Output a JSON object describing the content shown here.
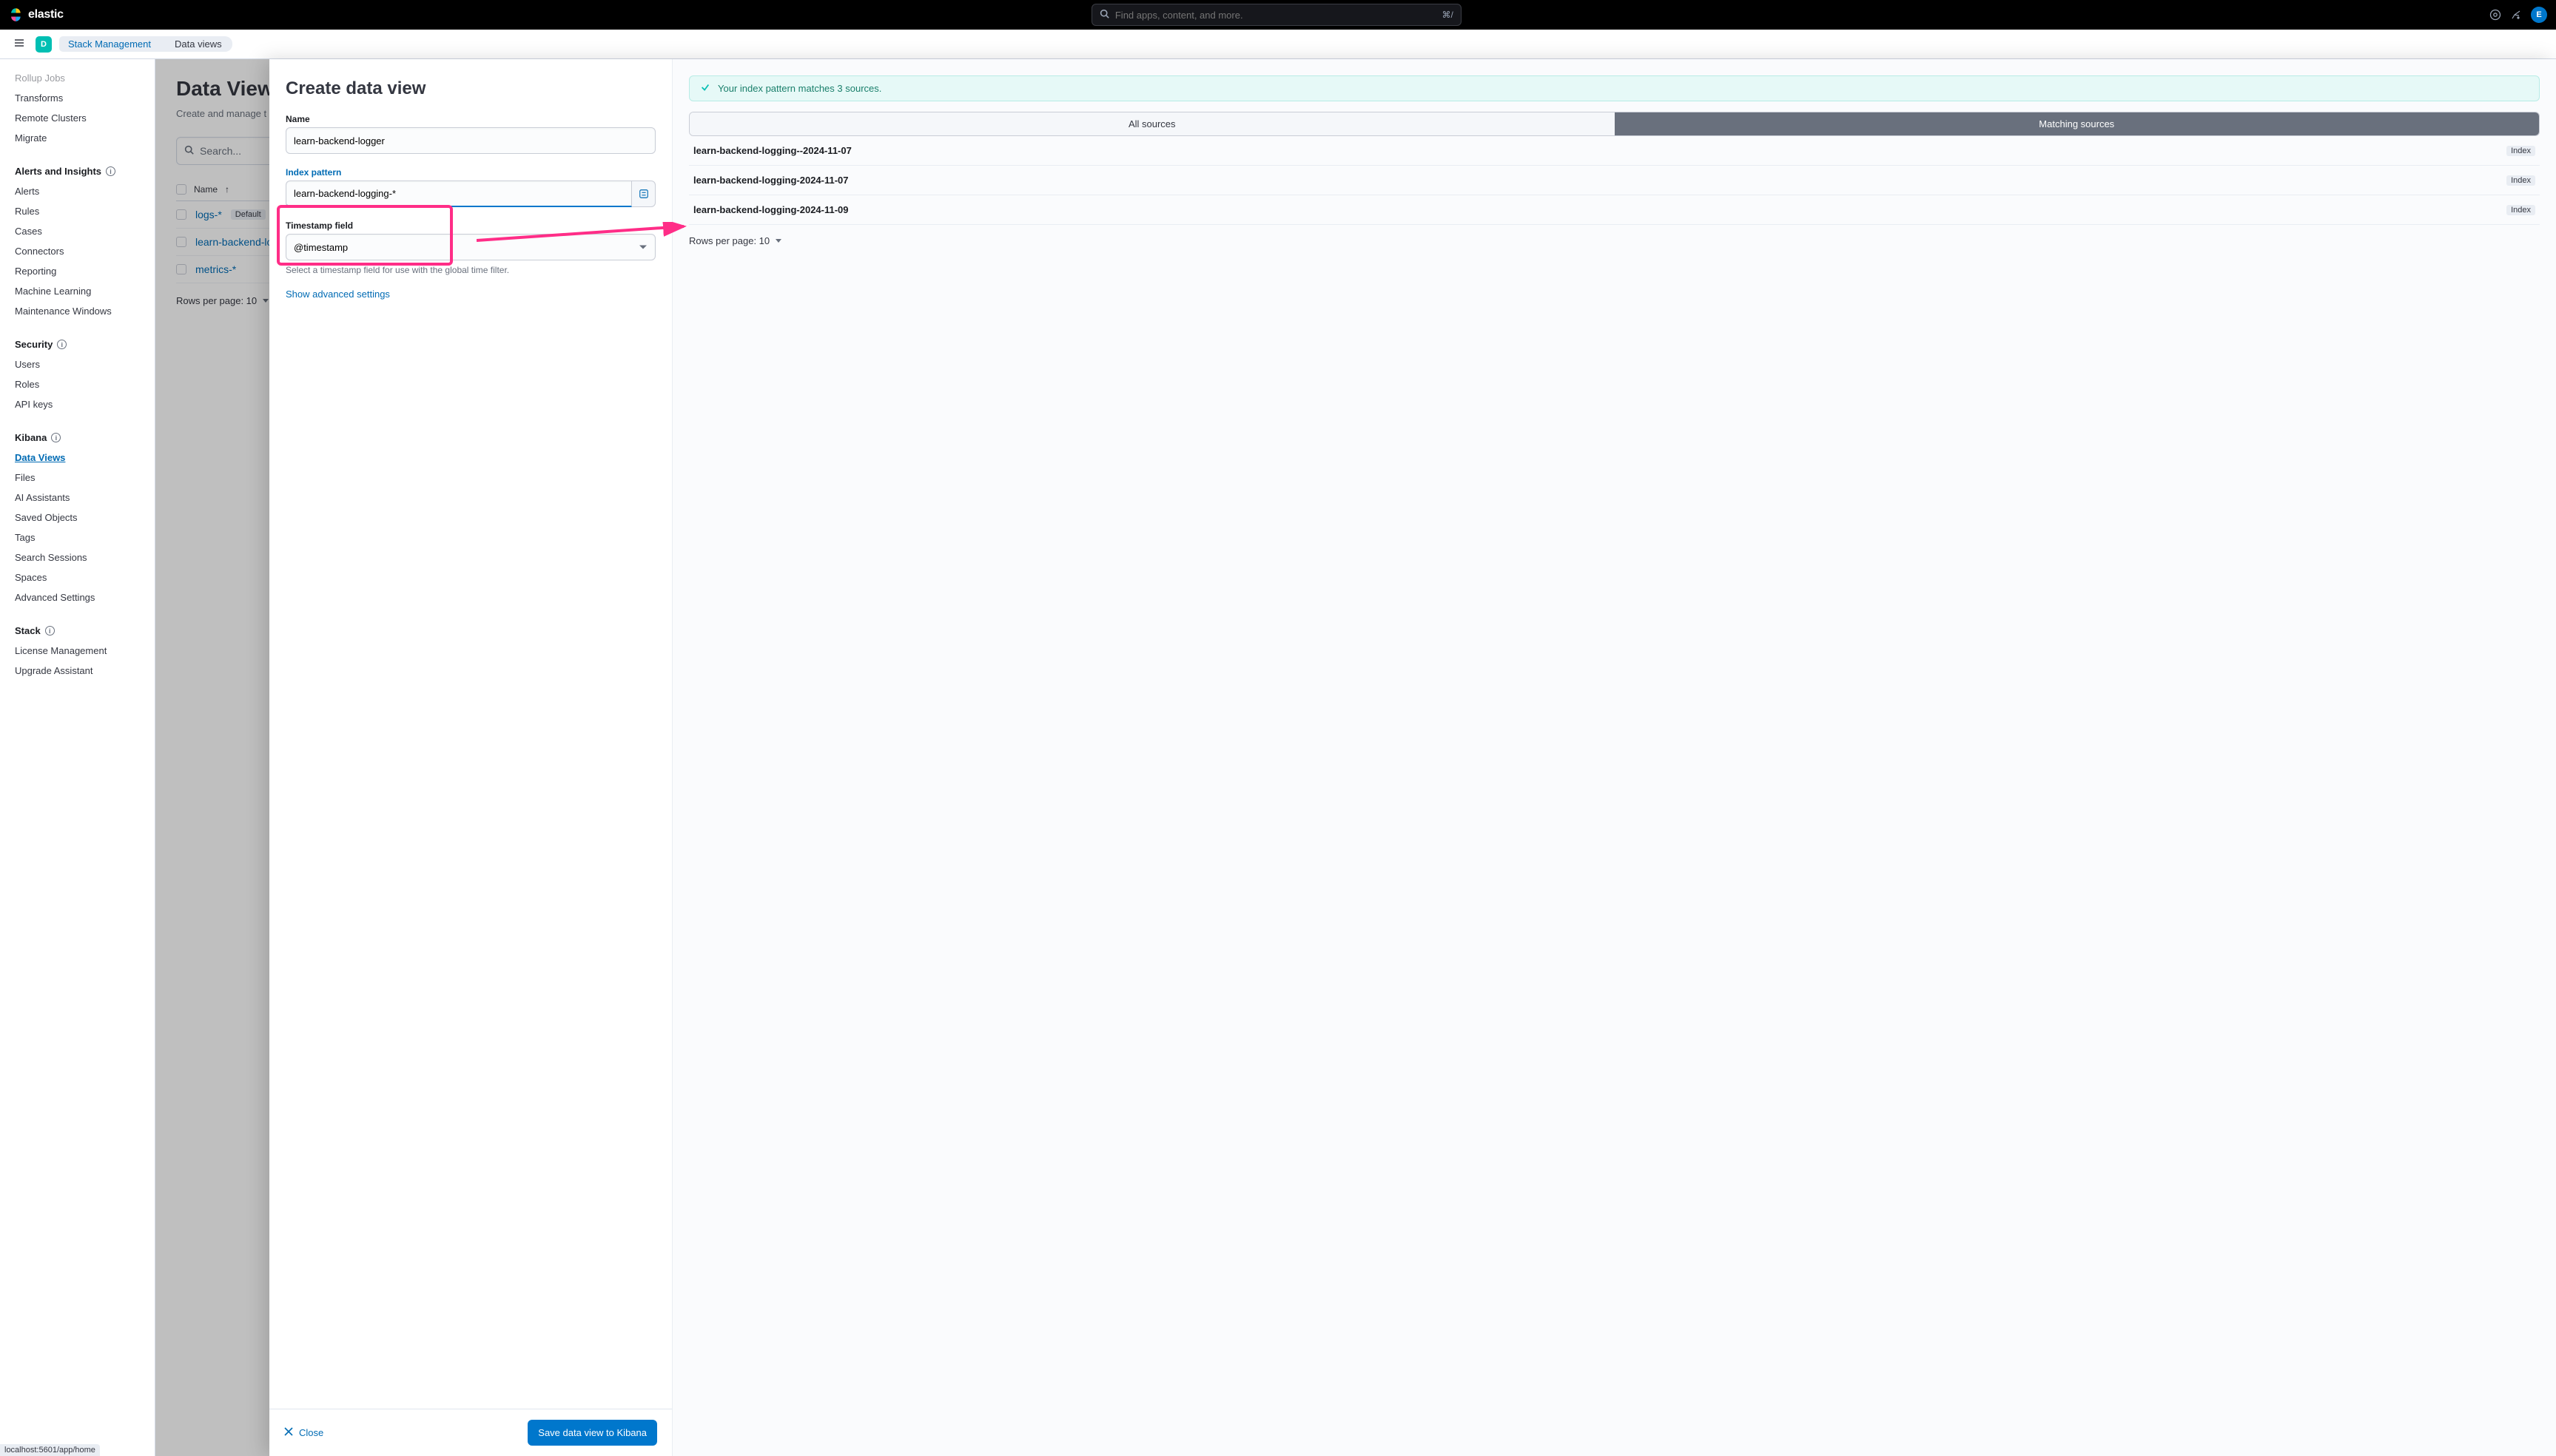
{
  "header": {
    "brand": "elastic",
    "search_placeholder": "Find apps, content, and more.",
    "search_shortcut": "⌘/",
    "avatar_letter": "E",
    "space_letter": "D"
  },
  "breadcrumbs": [
    "Stack Management",
    "Data views"
  ],
  "sidebar": {
    "groups": [
      {
        "title": "",
        "items": [
          "Rollup Jobs",
          "Transforms",
          "Remote Clusters",
          "Migrate"
        ]
      },
      {
        "title": "Alerts and Insights",
        "has_info": true,
        "items": [
          "Alerts",
          "Rules",
          "Cases",
          "Connectors",
          "Reporting",
          "Machine Learning",
          "Maintenance Windows"
        ]
      },
      {
        "title": "Security",
        "has_info": true,
        "items": [
          "Users",
          "Roles",
          "API keys"
        ]
      },
      {
        "title": "Kibana",
        "has_info": true,
        "items": [
          "Data Views",
          "Files",
          "AI Assistants",
          "Saved Objects",
          "Tags",
          "Search Sessions",
          "Spaces",
          "Advanced Settings"
        ],
        "active_index": 0
      },
      {
        "title": "Stack",
        "has_info": true,
        "items": [
          "License Management",
          "Upgrade Assistant"
        ]
      }
    ]
  },
  "main": {
    "title": "Data View",
    "subtitle": "Create and manage t",
    "search_placeholder": "Search...",
    "col_name": "Name",
    "rows": [
      {
        "name": "logs-*",
        "badge": "Default"
      },
      {
        "name": "learn-backend-log",
        "badge": null
      },
      {
        "name": "metrics-*",
        "badge": null
      }
    ],
    "rows_per_page": "Rows per page: 10"
  },
  "flyout": {
    "title": "Create data view",
    "name_label": "Name",
    "name_value": "learn-backend-logger",
    "pattern_label": "Index pattern",
    "pattern_value": "learn-backend-logging-*",
    "ts_label": "Timestamp field",
    "ts_value": "@timestamp",
    "ts_help": "Select a timestamp field for use with the global time filter.",
    "advanced": "Show advanced settings",
    "close": "Close",
    "save": "Save data view to Kibana"
  },
  "match": {
    "msg": "Your index pattern matches 3 sources.",
    "tab_all": "All sources",
    "tab_match": "Matching sources",
    "sources": [
      {
        "name": "learn-backend-logging--2024-11-07",
        "type": "Index"
      },
      {
        "name": "learn-backend-logging-2024-11-07",
        "type": "Index"
      },
      {
        "name": "learn-backend-logging-2024-11-09",
        "type": "Index"
      }
    ],
    "rows_per_page": "Rows per page: 10"
  },
  "status_url": "localhost:5601/app/home"
}
